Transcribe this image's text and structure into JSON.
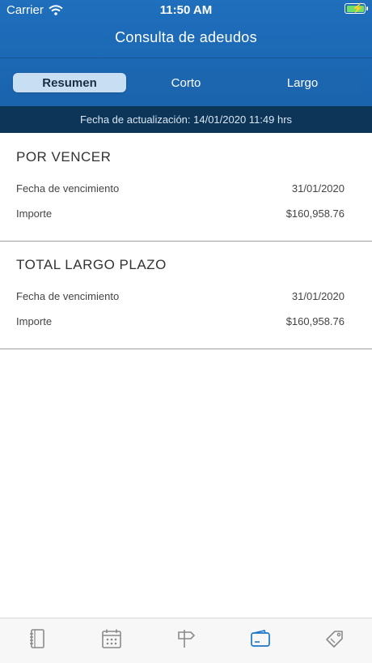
{
  "status_bar": {
    "carrier": "Carrier",
    "time": "11:50 AM"
  },
  "nav": {
    "title": "Consulta de adeudos"
  },
  "segments": [
    {
      "label": "Resumen",
      "active": true
    },
    {
      "label": "Corto",
      "active": false
    },
    {
      "label": "Largo",
      "active": false
    }
  ],
  "update_text": "Fecha de actualización: 14/01/2020 11:49 hrs",
  "sections": [
    {
      "title": "POR VENCER",
      "rows": [
        {
          "label": "Fecha de vencimiento",
          "value": "31/01/2020"
        },
        {
          "label": "Importe",
          "value": "$160,958.76"
        }
      ]
    },
    {
      "title": "TOTAL LARGO PLAZO",
      "rows": [
        {
          "label": "Fecha de vencimiento",
          "value": "31/01/2020"
        },
        {
          "label": "Importe",
          "value": "$160,958.76"
        }
      ]
    }
  ],
  "tab_bar": {
    "items": [
      {
        "icon": "notebook-icon",
        "active": false
      },
      {
        "icon": "calendar-icon",
        "active": false
      },
      {
        "icon": "signpost-icon",
        "active": false
      },
      {
        "icon": "wallet-icon",
        "active": true
      },
      {
        "icon": "tag-icon",
        "active": false
      }
    ]
  },
  "colors": {
    "header": "#1f6fbd",
    "update_bar": "#0d3558",
    "active_tab": "#1b76c9",
    "inactive_tab": "#8a8a8a"
  }
}
